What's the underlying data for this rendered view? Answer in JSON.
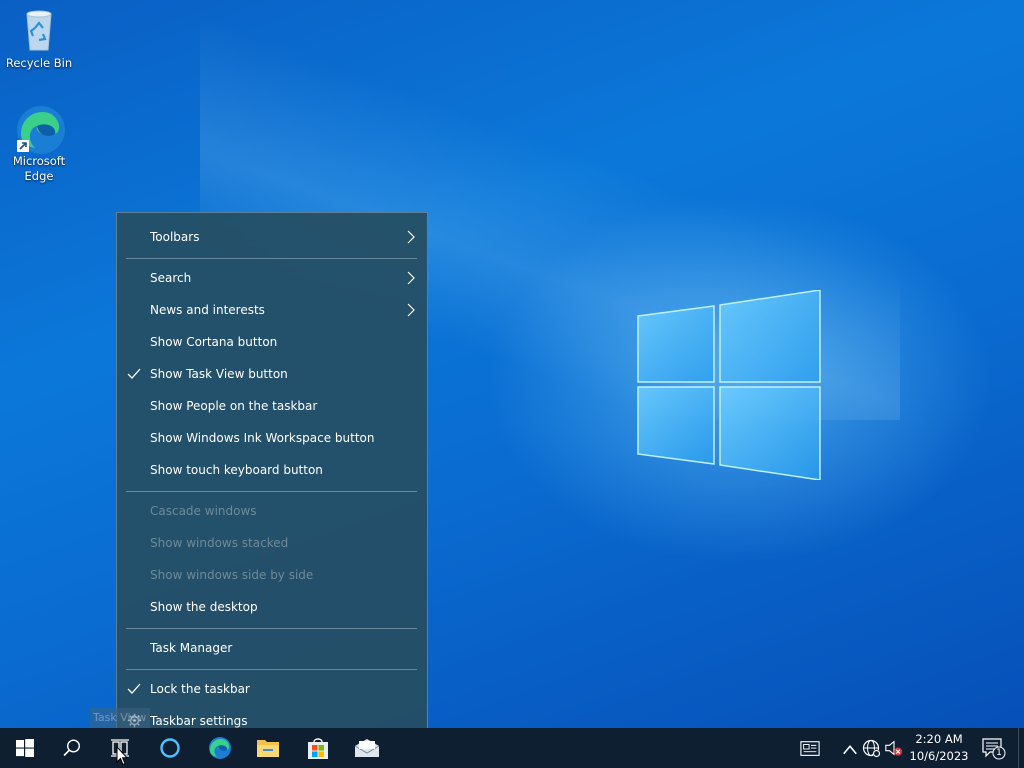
{
  "desktop": {
    "icons": [
      {
        "label": "Recycle Bin"
      },
      {
        "label": "Microsoft Edge"
      }
    ]
  },
  "context_menu": {
    "items": [
      {
        "label": "Toolbars",
        "submenu": true,
        "checked": false,
        "enabled": true
      },
      {
        "label": "Search",
        "submenu": true,
        "checked": false,
        "enabled": true
      },
      {
        "label": "News and interests",
        "submenu": true,
        "checked": false,
        "enabled": true
      },
      {
        "label": "Show Cortana button",
        "submenu": false,
        "checked": false,
        "enabled": true
      },
      {
        "label": "Show Task View button",
        "submenu": false,
        "checked": true,
        "enabled": true
      },
      {
        "label": "Show People on the taskbar",
        "submenu": false,
        "checked": false,
        "enabled": true
      },
      {
        "label": "Show Windows Ink Workspace button",
        "submenu": false,
        "checked": false,
        "enabled": true
      },
      {
        "label": "Show touch keyboard button",
        "submenu": false,
        "checked": false,
        "enabled": true
      },
      {
        "label": "Cascade windows",
        "submenu": false,
        "checked": false,
        "enabled": false
      },
      {
        "label": "Show windows stacked",
        "submenu": false,
        "checked": false,
        "enabled": false
      },
      {
        "label": "Show windows side by side",
        "submenu": false,
        "checked": false,
        "enabled": false
      },
      {
        "label": "Show the desktop",
        "submenu": false,
        "checked": false,
        "enabled": true
      },
      {
        "label": "Task Manager",
        "submenu": false,
        "checked": false,
        "enabled": true
      },
      {
        "label": "Lock the taskbar",
        "submenu": false,
        "checked": true,
        "enabled": true
      },
      {
        "label": "Taskbar settings",
        "submenu": false,
        "checked": false,
        "enabled": true,
        "icon": "gear-icon"
      }
    ]
  },
  "tooltip": {
    "text": "Task View"
  },
  "taskbar": {
    "buttons": [
      "start-icon",
      "search-icon",
      "task-view-icon",
      "cortana-icon",
      "edge-icon",
      "file-explorer-icon",
      "store-icon",
      "mail-icon"
    ],
    "tray": {
      "icons": [
        "news-icon",
        "show-hidden-icons-chevron",
        "network-icon",
        "volume-muted-icon"
      ],
      "time": "2:20 AM",
      "date": "10/6/2023",
      "notification_count": "1"
    }
  },
  "colors": {
    "taskbar": "#0f1f32",
    "menu_bg": "#264e62",
    "desktop_blue": "#0b78d9"
  }
}
